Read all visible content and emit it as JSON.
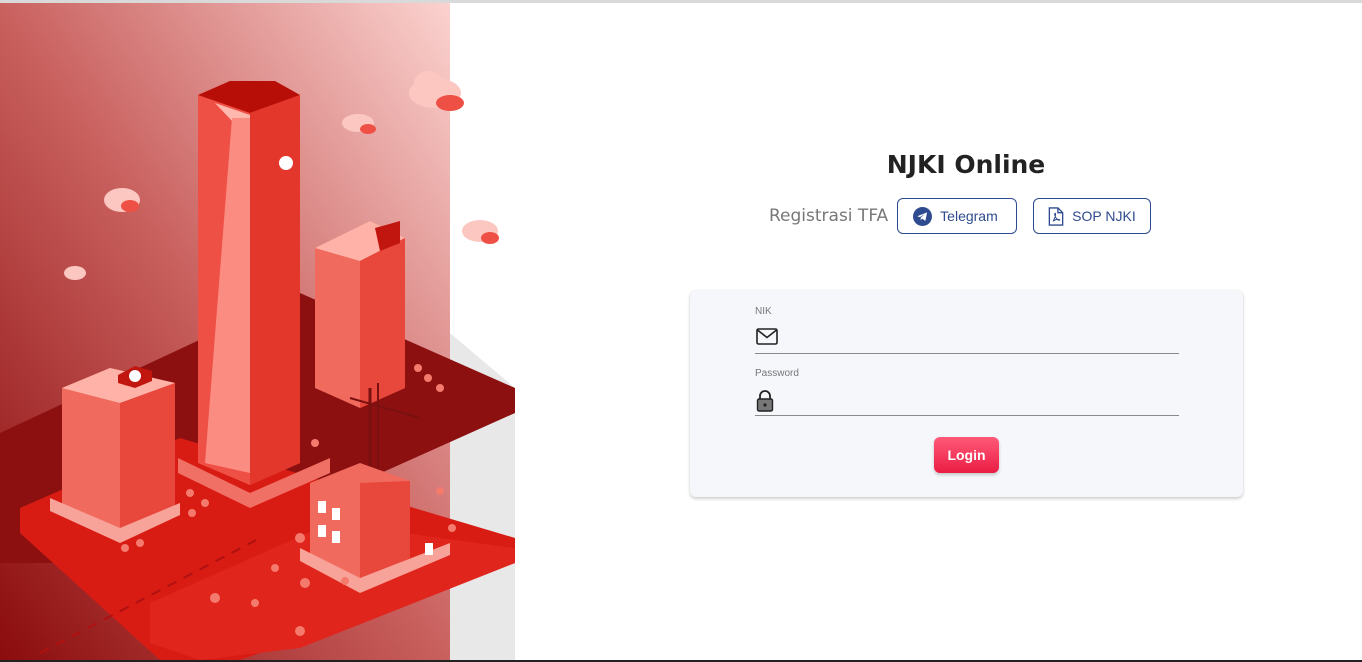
{
  "page": {
    "title": "NJKI Online"
  },
  "links": {
    "registrasi_label": "Registrasi TFA",
    "telegram_label": "Telegram",
    "sop_label": "SOP NJKI"
  },
  "login_form": {
    "nik_label": "NIK",
    "nik_value": "",
    "password_label": "Password",
    "password_value": "",
    "login_label": "Login"
  },
  "colors": {
    "primary_blue": "#2f4b8f",
    "login_red": "#ea1c44",
    "illustration_red": "#e0251c"
  },
  "icons": {
    "telegram": "telegram-icon",
    "sop": "pdf-file-icon",
    "nik": "mail-icon",
    "password": "lock-icon"
  }
}
